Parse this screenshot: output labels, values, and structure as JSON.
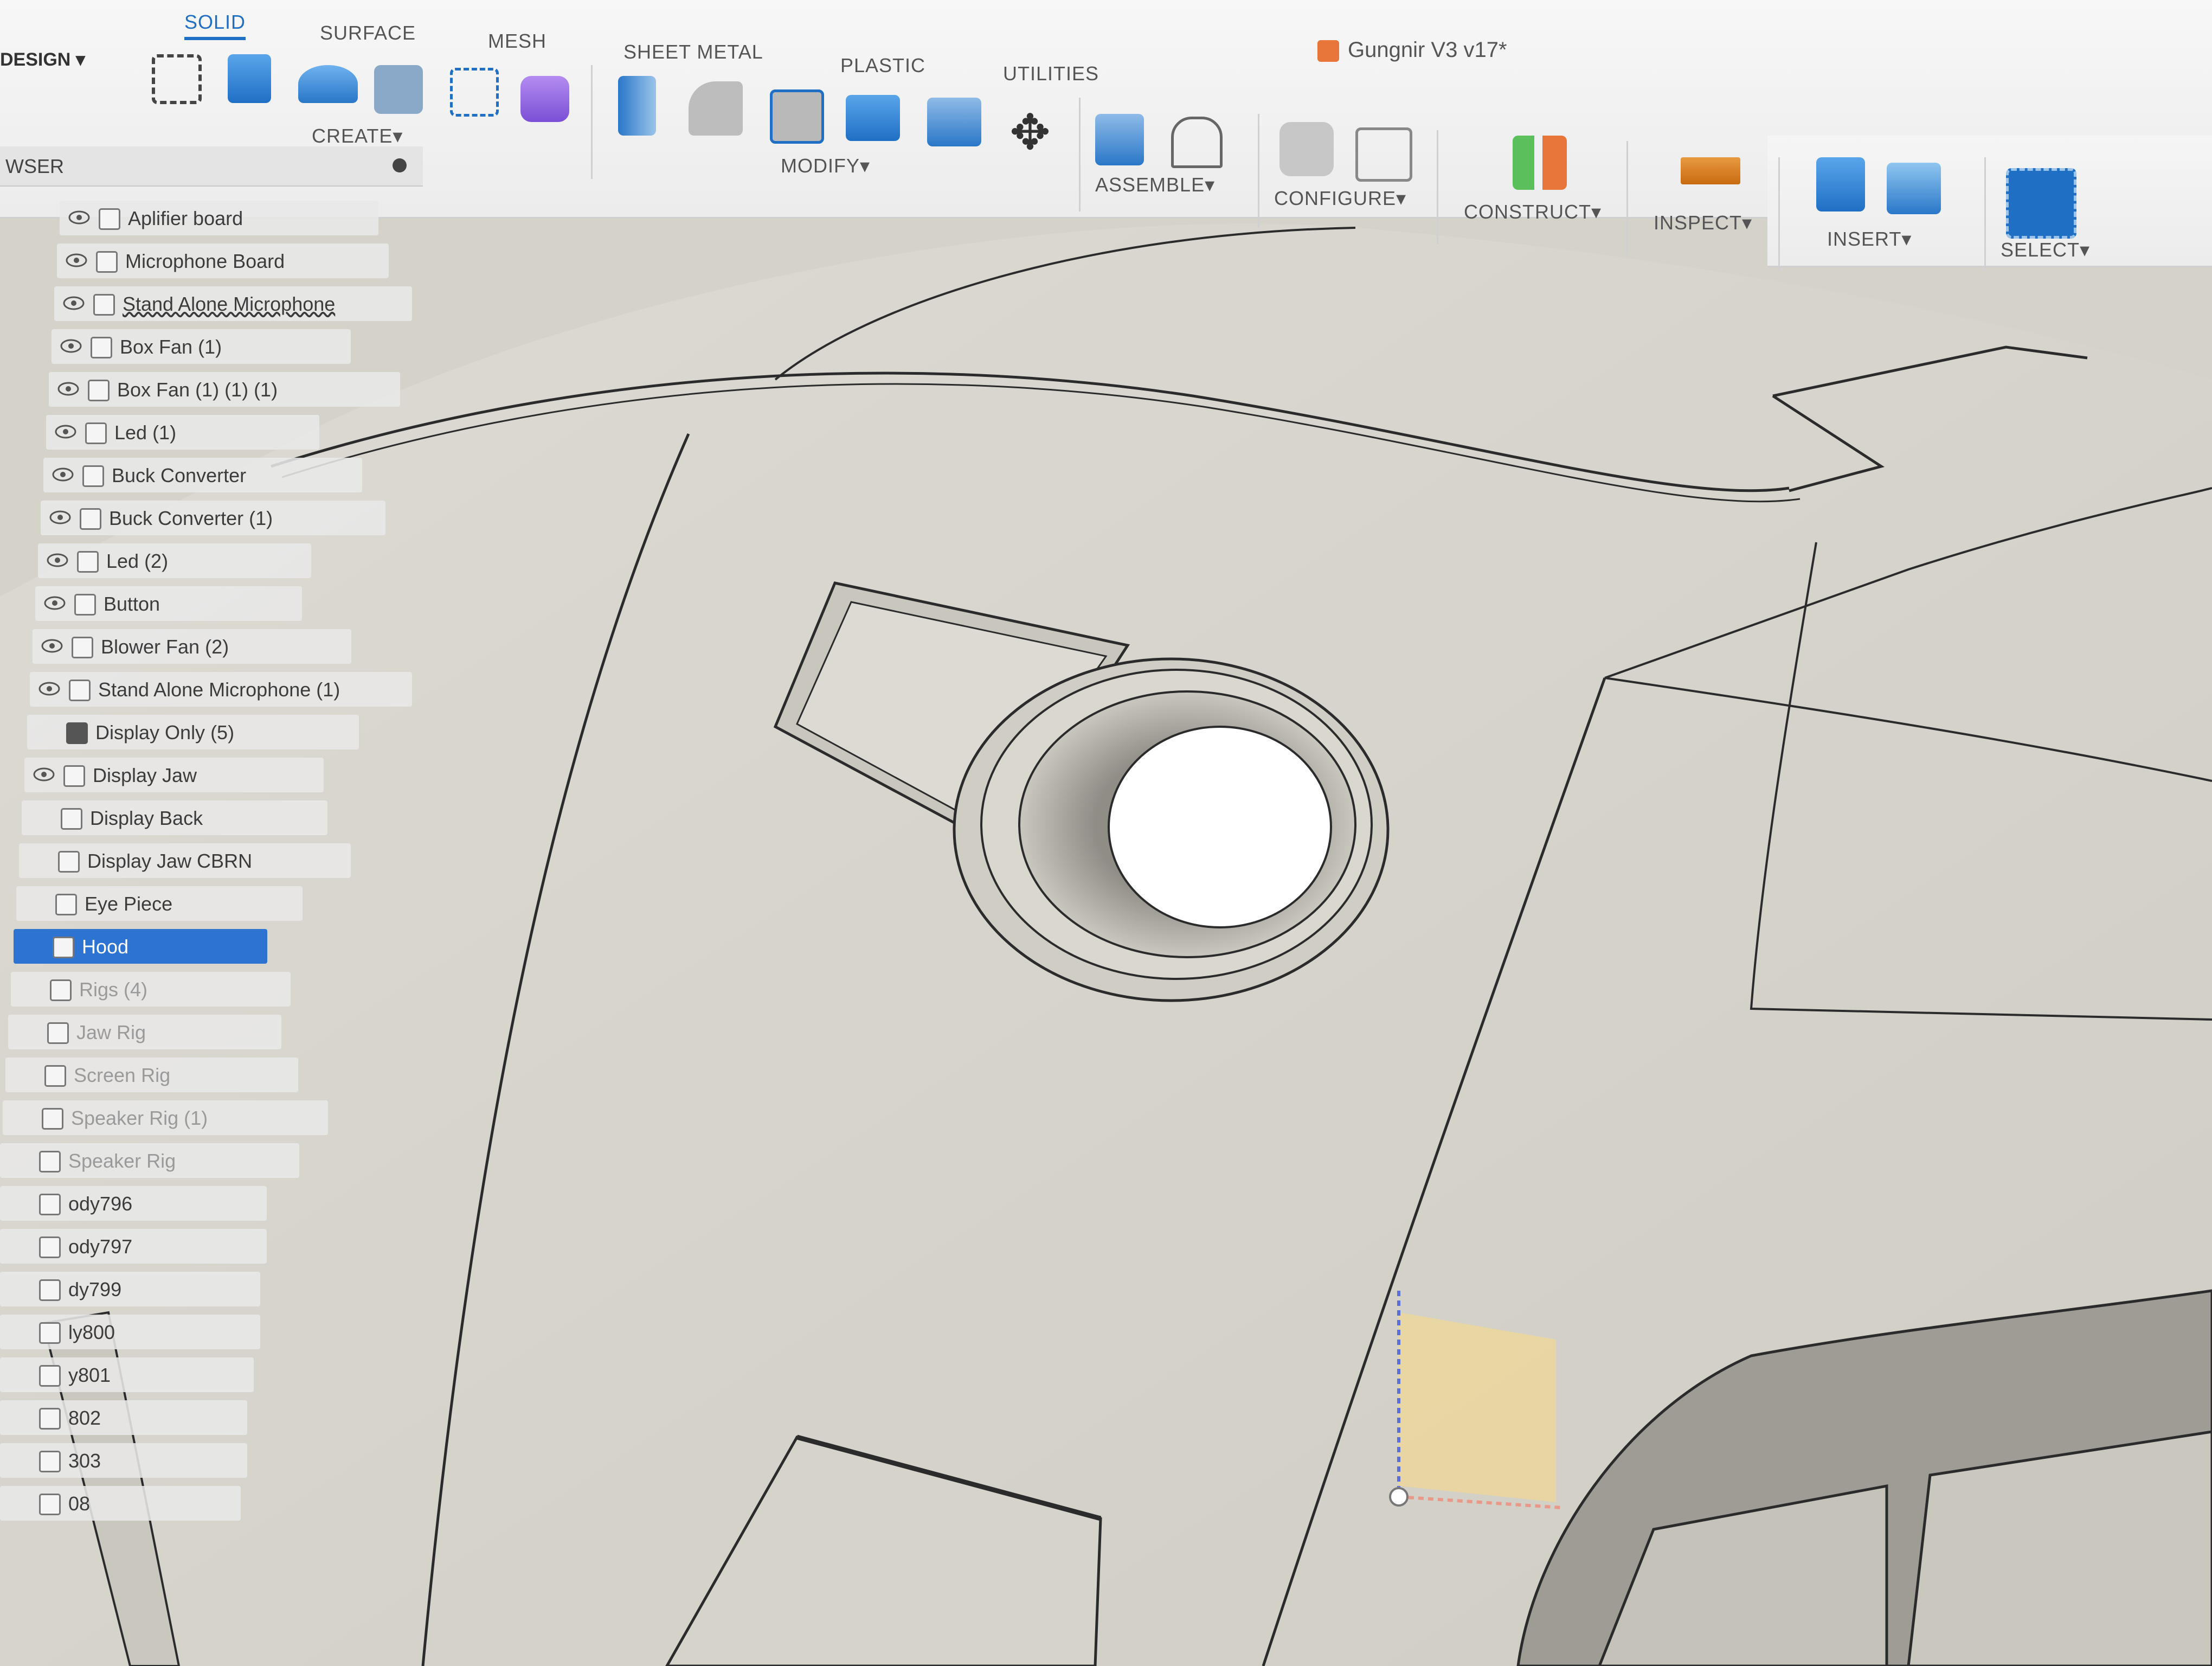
{
  "app": {
    "workspace": "DESIGN",
    "document_title": "Gungnir V3 v17*"
  },
  "toolbar": {
    "tabs": [
      {
        "label": "SOLID",
        "active": true
      },
      {
        "label": "SURFACE",
        "active": false
      },
      {
        "label": "MESH",
        "active": false
      },
      {
        "label": "SHEET METAL",
        "active": false
      },
      {
        "label": "PLASTIC",
        "active": false
      },
      {
        "label": "UTILITIES",
        "active": false
      }
    ],
    "groups": [
      {
        "label": "CREATE"
      },
      {
        "label": "MODIFY"
      },
      {
        "label": "ASSEMBLE"
      },
      {
        "label": "CONFIGURE"
      },
      {
        "label": "CONSTRUCT"
      },
      {
        "label": "INSPECT"
      },
      {
        "label": "INSERT"
      },
      {
        "label": "SELECT"
      }
    ],
    "dropdown_marker": "▾"
  },
  "browser": {
    "title": "WSER",
    "items": [
      {
        "label": "Aplifier board",
        "eye": true
      },
      {
        "label": "Microphone Board",
        "eye": true
      },
      {
        "label": "Stand Alone Microphone",
        "eye": true,
        "underline": true
      },
      {
        "label": "Box Fan (1)",
        "eye": true
      },
      {
        "label": "Box Fan (1) (1) (1)",
        "eye": true
      },
      {
        "label": "Led (1)",
        "eye": true
      },
      {
        "label": "Buck Converter",
        "eye": true
      },
      {
        "label": "Buck Converter (1)",
        "eye": true
      },
      {
        "label": "Led (2)",
        "eye": true
      },
      {
        "label": "Button",
        "eye": true
      },
      {
        "label": "Blower Fan (2)",
        "eye": true
      },
      {
        "label": "Stand Alone Microphone (1)",
        "eye": true
      },
      {
        "label": "Display Only (5)",
        "folder": true
      },
      {
        "label": "Display Jaw",
        "eye": true
      },
      {
        "label": "Display Back"
      },
      {
        "label": "Display Jaw CBRN"
      },
      {
        "label": "Eye Piece"
      },
      {
        "label": "Hood",
        "selected": true
      },
      {
        "label": "Rigs (4)",
        "faded": true
      },
      {
        "label": "Jaw Rig",
        "faded": true
      },
      {
        "label": "Screen Rig",
        "faded": true
      },
      {
        "label": "Speaker Rig (1)",
        "faded": true
      },
      {
        "label": "Speaker Rig",
        "faded": true
      },
      {
        "label": "ody796"
      },
      {
        "label": "ody797"
      },
      {
        "label": "dy799"
      },
      {
        "label": "ly800"
      },
      {
        "label": "y801"
      },
      {
        "label": "802"
      },
      {
        "label": "303"
      },
      {
        "label": "08"
      }
    ]
  },
  "colors": {
    "accent": "#1f6fc5",
    "selected_row": "#2d73d2",
    "model_surface": "#d9d7cf",
    "model_edge": "#2b2b2b",
    "origin_plane": "#f6d88a"
  }
}
